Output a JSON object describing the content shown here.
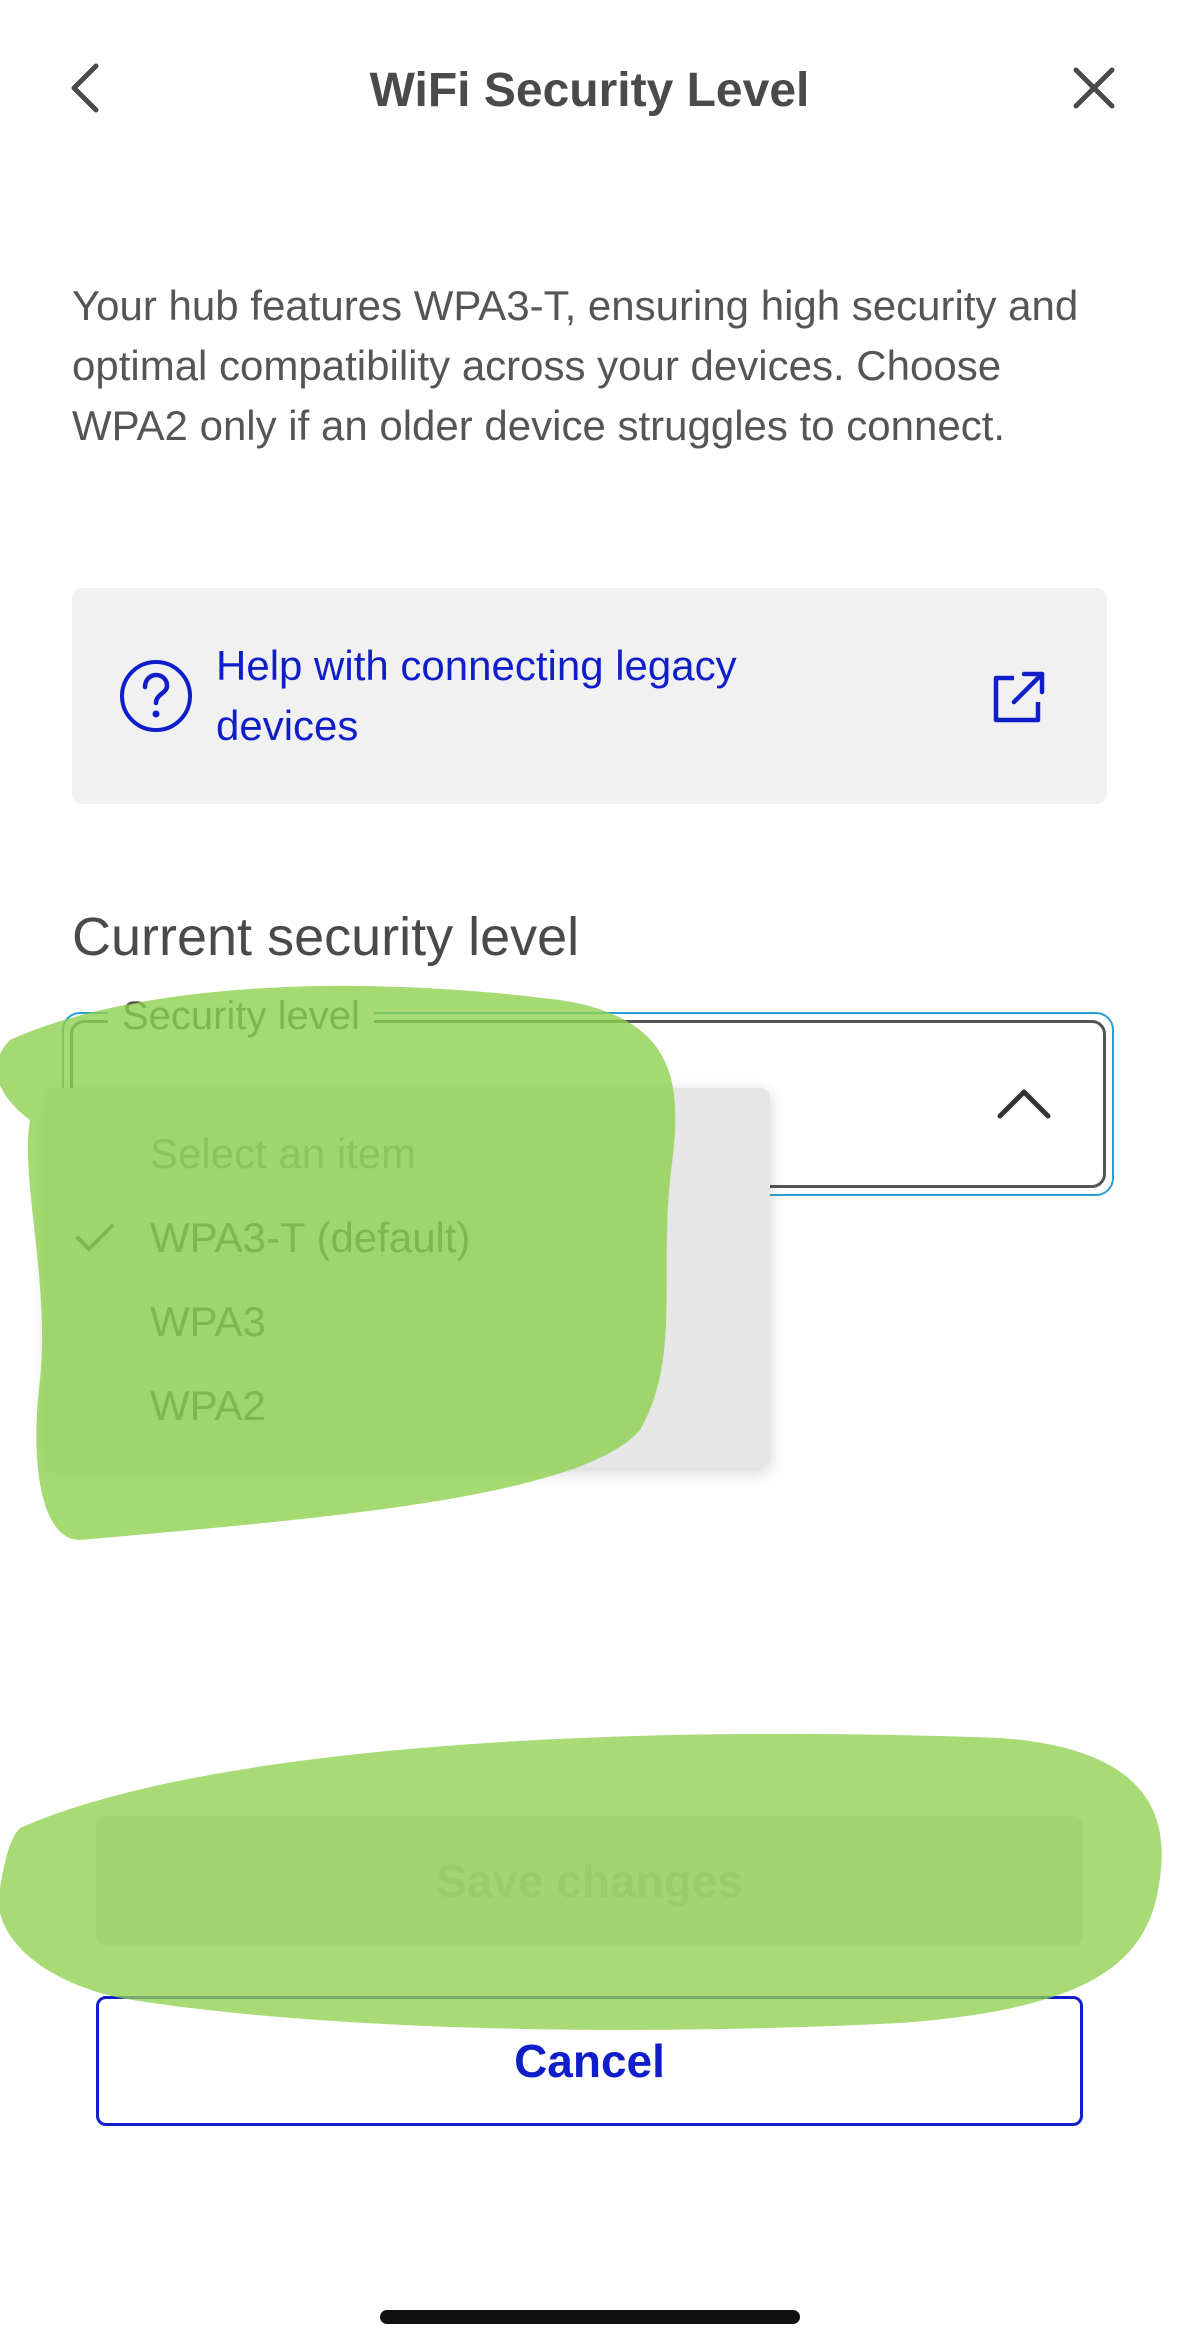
{
  "header": {
    "title": "WiFi Security Level",
    "back_icon": "chevron-left-icon",
    "close_icon": "close-icon"
  },
  "description": "Your hub features WPA3-T, ensuring high security and optimal compatibility across your devices. Choose WPA2 only if an older device struggles to connect.",
  "help_card": {
    "label": "Help with connecting legacy devices",
    "icon": "question-circle-icon",
    "trailing_icon": "external-link-icon"
  },
  "section_heading": "Current security level",
  "select": {
    "label": "Security level",
    "state": "expanded",
    "chevron_icon": "chevron-up-icon",
    "options": [
      {
        "label": "Select an item",
        "placeholder": true,
        "selected": false
      },
      {
        "label": "WPA3-T (default)",
        "placeholder": false,
        "selected": true
      },
      {
        "label": "WPA3",
        "placeholder": false,
        "selected": false
      },
      {
        "label": "WPA2",
        "placeholder": false,
        "selected": false
      }
    ]
  },
  "buttons": {
    "save_label": "Save changes",
    "save_disabled": true,
    "cancel_label": "Cancel"
  },
  "colors": {
    "accent_blue": "#0f1ec8",
    "focus_ring": "#2a9fd6",
    "highlight_green": "#8fd14f",
    "card_bg": "#f1f1f1",
    "dropdown_bg": "#e6e6e6"
  }
}
